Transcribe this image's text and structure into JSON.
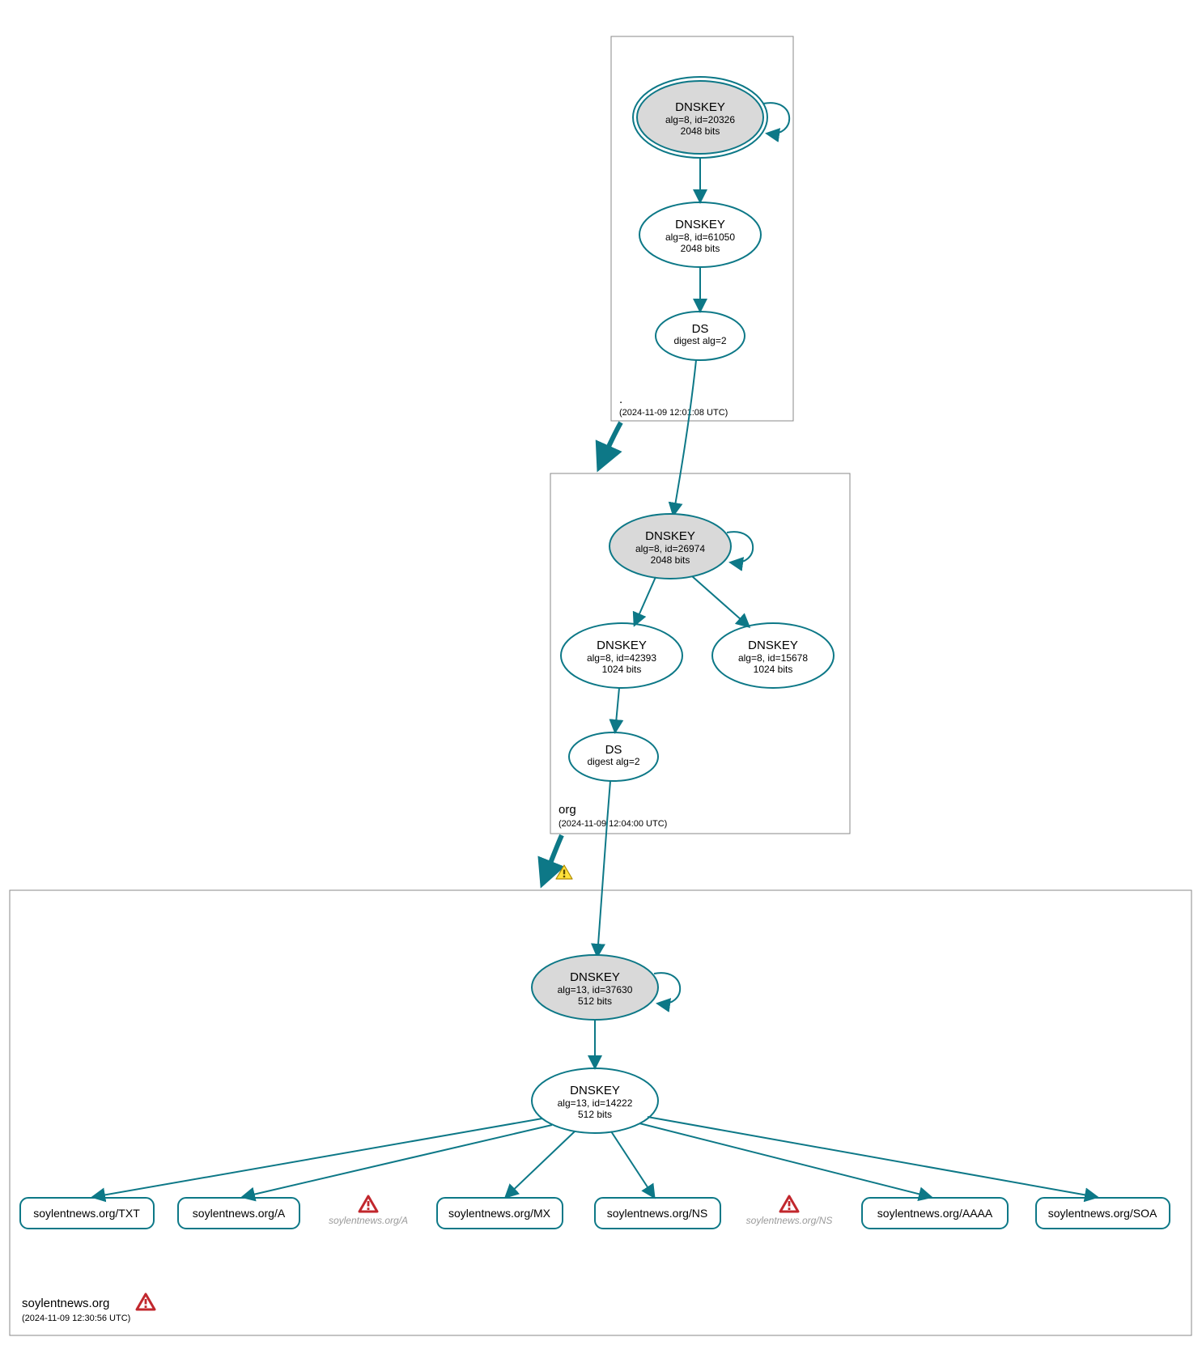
{
  "colors": {
    "stroke": "#0d7887",
    "grey": "#d9d9d9"
  },
  "zones": {
    "root": {
      "label": ".",
      "timestamp": "(2024-11-09 12:01:08 UTC)"
    },
    "org": {
      "label": "org",
      "timestamp": "(2024-11-09 12:04:00 UTC)"
    },
    "leaf": {
      "label": "soylentnews.org",
      "timestamp": "(2024-11-09 12:30:56 UTC)"
    }
  },
  "nodes": {
    "root_ksk": {
      "title": "DNSKEY",
      "line2": "alg=8, id=20326",
      "line3": "2048 bits"
    },
    "root_zsk": {
      "title": "DNSKEY",
      "line2": "alg=8, id=61050",
      "line3": "2048 bits"
    },
    "root_ds": {
      "title": "DS",
      "line2": "digest alg=2"
    },
    "org_ksk": {
      "title": "DNSKEY",
      "line2": "alg=8, id=26974",
      "line3": "2048 bits"
    },
    "org_zsk1": {
      "title": "DNSKEY",
      "line2": "alg=8, id=42393",
      "line3": "1024 bits"
    },
    "org_zsk2": {
      "title": "DNSKEY",
      "line2": "alg=8, id=15678",
      "line3": "1024 bits"
    },
    "org_ds": {
      "title": "DS",
      "line2": "digest alg=2"
    },
    "leaf_ksk": {
      "title": "DNSKEY",
      "line2": "alg=13, id=37630",
      "line3": "512 bits"
    },
    "leaf_zsk": {
      "title": "DNSKEY",
      "line2": "alg=13, id=14222",
      "line3": "512 bits"
    }
  },
  "records": [
    "soylentnews.org/TXT",
    "soylentnews.org/A",
    "soylentnews.org/MX",
    "soylentnews.org/NS",
    "soylentnews.org/AAAA",
    "soylentnews.org/SOA"
  ],
  "ghosts": [
    "soylentnews.org/A",
    "soylentnews.org/NS"
  ]
}
